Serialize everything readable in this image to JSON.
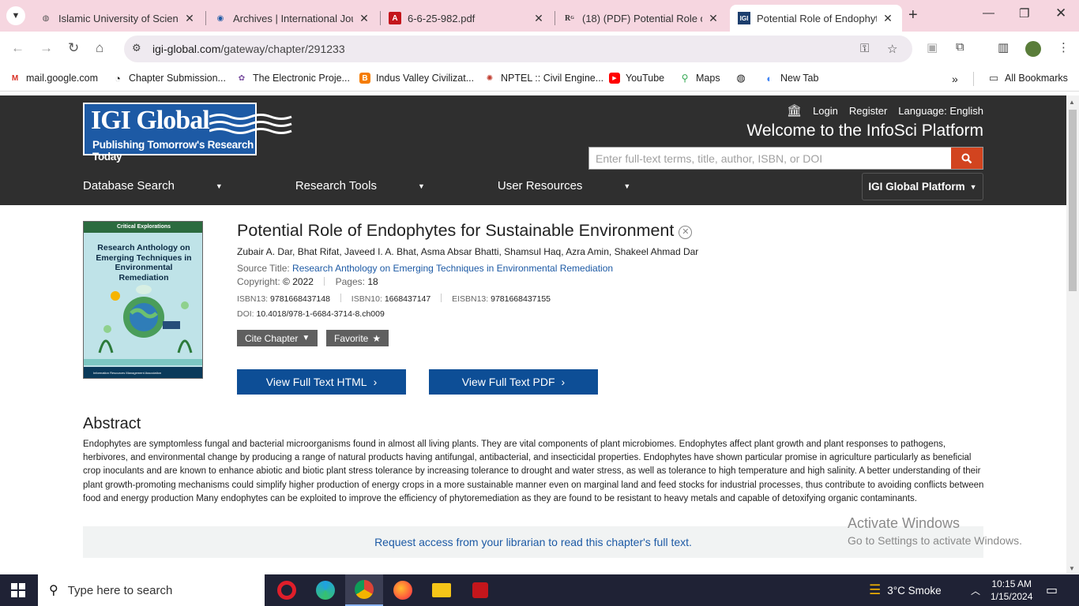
{
  "browser": {
    "tabs": [
      {
        "title": "Islamic University of Science",
        "favicon": "globe-icon",
        "active": false
      },
      {
        "title": "Archives | International Journ",
        "favicon": "journal-icon",
        "active": false
      },
      {
        "title": "6-6-25-982.pdf",
        "favicon": "pdf-icon",
        "active": false
      },
      {
        "title": "(18) (PDF) Potential Role of E",
        "favicon": "researchgate-icon",
        "active": false
      },
      {
        "title": "Potential Role of Endophytes",
        "favicon": "igi-icon",
        "active": true
      }
    ],
    "url_host": "igi-global.com",
    "url_path": "/gateway/chapter/291233",
    "bookmarks": [
      {
        "label": "mail.google.com",
        "icon": "gmail-icon",
        "color": "#d93025"
      },
      {
        "label": "Chapter Submission...",
        "icon": "chapter-icon",
        "color": "#222222"
      },
      {
        "label": "The Electronic Proje...",
        "icon": "electronic-icon",
        "color": "#7a4fa0"
      },
      {
        "label": "Indus Valley Civilizat...",
        "icon": "blogger-icon",
        "color": "#f57c00"
      },
      {
        "label": "NPTEL :: Civil Engine...",
        "icon": "nptel-icon",
        "color": "#c0392b"
      },
      {
        "label": "YouTube",
        "icon": "youtube-icon",
        "color": "#ff0000"
      },
      {
        "label": "Maps",
        "icon": "maps-icon",
        "color": "#34a853"
      },
      {
        "label": "",
        "icon": "globe-icon",
        "color": "#222222"
      },
      {
        "label": "New Tab",
        "icon": "newtab-icon",
        "color": "#4285f4"
      }
    ],
    "all_bookmarks": "All Bookmarks"
  },
  "header": {
    "logo_main": "IGI Global",
    "logo_tag": "Publishing Tomorrow's Research Today",
    "login": "Login",
    "register": "Register",
    "language": "Language: English",
    "welcome": "Welcome to the InfoSci Platform",
    "search_placeholder": "Enter full-text terms, title, author, ISBN, or DOI",
    "nav": [
      "Database Search",
      "Research Tools",
      "User Resources"
    ],
    "platform": "IGI Global Platform"
  },
  "book": {
    "series": "Critical Explorations",
    "cover_title": "Research Anthology on Emerging Techniques in Environmental Remediation",
    "publisher_line": "Information Resources Management Association"
  },
  "chapter": {
    "title": "Potential Role of Endophytes for Sustainable Environment",
    "authors": "Zubair A. Dar, Bhat Rifat, Javeed I. A. Bhat, Asma Absar Bhatti, Shamsul Haq, Azra Amin, Shakeel Ahmad Dar",
    "source_label": "Source Title:",
    "source_title": "Research Anthology on Emerging Techniques in Environmental Remediation",
    "copyright_label": "Copyright:",
    "copyright_value": "© 2022",
    "pages_label": "Pages:",
    "pages_value": "18",
    "isbn13_label": "ISBN13:",
    "isbn13": "9781668437148",
    "isbn10_label": "ISBN10:",
    "isbn10": "1668437147",
    "eisbn13_label": "EISBN13:",
    "eisbn13": "9781668437155",
    "doi_label": "DOI:",
    "doi": "10.4018/978-1-6684-3714-8.ch009",
    "cite_label": "Cite Chapter",
    "favorite_label": "Favorite",
    "html_button": "View Full Text HTML",
    "pdf_button": "View Full Text PDF",
    "abstract_heading": "Abstract",
    "abstract": "Endophytes are symptomless fungal and bacterial microorganisms found in almost all living plants. They are vital components of plant microbiomes. Endophytes affect plant growth and plant responses to pathogens, herbivores, and environmental change by producing a range of natural products having antifungal, antibacterial, and insecticidal properties. Endophytes have shown particular promise in agriculture particularly as beneficial crop inoculants and are known to enhance abiotic and biotic plant stress tolerance by increasing tolerance to drought and water stress, as well as tolerance to high temperature and high salinity. A better understanding of their plant growth-promoting mechanisms could simplify higher production of energy crops in a more sustainable manner even on marginal land and feed stocks for industrial processes, thus contribute to avoiding conflicts between food and energy production Many endophytes can be exploited to improve the efficiency of phytoremediation as they are found to be resistant to heavy metals and capable of detoxifying organic contaminants.",
    "request_access": "Request access from your librarian to read this chapter's full text."
  },
  "watermark": {
    "line1": "Activate Windows",
    "line2": "Go to Settings to activate Windows."
  },
  "taskbar": {
    "search_placeholder": "Type here to search",
    "apps": [
      "opera-icon",
      "edge-icon",
      "chrome-icon",
      "firefox-icon",
      "file-explorer-icon",
      "acrobat-icon"
    ],
    "weather": "3°C  Smoke",
    "time": "10:15 AM",
    "date": "1/15/2024"
  },
  "colors": {
    "tabstrip": "#f6d6e0",
    "site_header": "#2f2f2f",
    "igi_blue": "#1d5aa5",
    "button_blue": "#0d4e96",
    "search_orange": "#d2441f"
  }
}
